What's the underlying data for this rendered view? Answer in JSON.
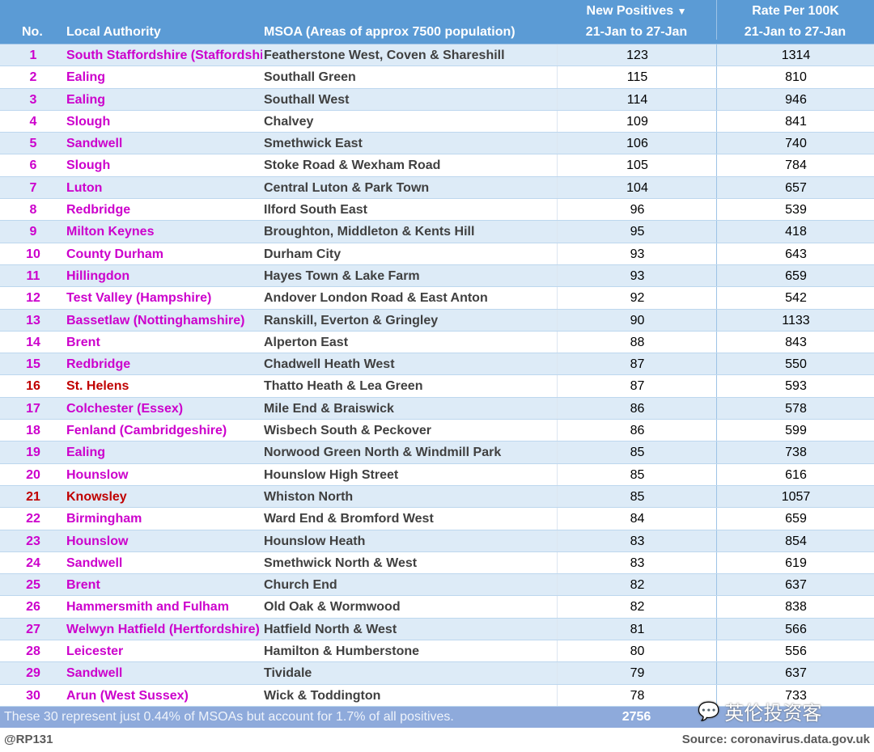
{
  "header": {
    "no": "No.",
    "la": "Local Authority",
    "msoa": "MSOA (Areas of approx 7500 population)",
    "np_title": "New Positives",
    "np_sort_icon": "triangle-down",
    "np_period": "21-Jan to 27-Jan",
    "rate_title": "Rate Per 100K",
    "rate_period": "21-Jan to 27-Jan"
  },
  "colors": {
    "header": "#5b9bd5",
    "alt_row": "#ddebf7",
    "authority_default": "#cc00cc",
    "authority_highlight": "#c00000",
    "footer": "#8eaadb"
  },
  "rows": [
    {
      "no": "1",
      "la": "South Staffordshire (Staffordshire)",
      "msoa": "Featherstone West, Coven & Shareshill",
      "np": "123",
      "rate": "1314"
    },
    {
      "no": "2",
      "la": "Ealing",
      "msoa": "Southall Green",
      "np": "115",
      "rate": "810"
    },
    {
      "no": "3",
      "la": "Ealing",
      "msoa": "Southall West",
      "np": "114",
      "rate": "946"
    },
    {
      "no": "4",
      "la": "Slough",
      "msoa": "Chalvey",
      "np": "109",
      "rate": "841"
    },
    {
      "no": "5",
      "la": "Sandwell",
      "msoa": "Smethwick East",
      "np": "106",
      "rate": "740"
    },
    {
      "no": "6",
      "la": "Slough",
      "msoa": "Stoke Road & Wexham Road",
      "np": "105",
      "rate": "784"
    },
    {
      "no": "7",
      "la": "Luton",
      "msoa": "Central Luton & Park Town",
      "np": "104",
      "rate": "657"
    },
    {
      "no": "8",
      "la": "Redbridge",
      "msoa": "Ilford South East",
      "np": "96",
      "rate": "539"
    },
    {
      "no": "9",
      "la": "Milton Keynes",
      "msoa": "Broughton, Middleton & Kents Hill",
      "np": "95",
      "rate": "418"
    },
    {
      "no": "10",
      "la": "County Durham",
      "msoa": "Durham City",
      "np": "93",
      "rate": "643"
    },
    {
      "no": "11",
      "la": "Hillingdon",
      "msoa": "Hayes Town & Lake Farm",
      "np": "93",
      "rate": "659"
    },
    {
      "no": "12",
      "la": "Test Valley (Hampshire)",
      "msoa": "Andover London Road & East Anton",
      "np": "92",
      "rate": "542"
    },
    {
      "no": "13",
      "la": "Bassetlaw (Nottinghamshire)",
      "msoa": "Ranskill, Everton & Gringley",
      "np": "90",
      "rate": "1133"
    },
    {
      "no": "14",
      "la": "Brent",
      "msoa": "Alperton East",
      "np": "88",
      "rate": "843"
    },
    {
      "no": "15",
      "la": "Redbridge",
      "msoa": "Chadwell Heath West",
      "np": "87",
      "rate": "550"
    },
    {
      "no": "16",
      "la": "St. Helens",
      "msoa": "Thatto Heath & Lea Green",
      "np": "87",
      "rate": "593",
      "highlight": true
    },
    {
      "no": "17",
      "la": "Colchester (Essex)",
      "msoa": "Mile End & Braiswick",
      "np": "86",
      "rate": "578"
    },
    {
      "no": "18",
      "la": "Fenland (Cambridgeshire)",
      "msoa": "Wisbech South & Peckover",
      "np": "86",
      "rate": "599"
    },
    {
      "no": "19",
      "la": "Ealing",
      "msoa": "Norwood Green North & Windmill Park",
      "np": "85",
      "rate": "738"
    },
    {
      "no": "20",
      "la": "Hounslow",
      "msoa": "Hounslow High Street",
      "np": "85",
      "rate": "616"
    },
    {
      "no": "21",
      "la": "Knowsley",
      "msoa": "Whiston North",
      "np": "85",
      "rate": "1057",
      "highlight": true
    },
    {
      "no": "22",
      "la": "Birmingham",
      "msoa": "Ward End & Bromford West",
      "np": "84",
      "rate": "659"
    },
    {
      "no": "23",
      "la": "Hounslow",
      "msoa": "Hounslow Heath",
      "np": "83",
      "rate": "854"
    },
    {
      "no": "24",
      "la": "Sandwell",
      "msoa": "Smethwick North & West",
      "np": "83",
      "rate": "619"
    },
    {
      "no": "25",
      "la": "Brent",
      "msoa": "Church End",
      "np": "82",
      "rate": "637"
    },
    {
      "no": "26",
      "la": "Hammersmith and Fulham",
      "msoa": "Old Oak & Wormwood",
      "np": "82",
      "rate": "838"
    },
    {
      "no": "27",
      "la": "Welwyn Hatfield (Hertfordshire)",
      "msoa": "Hatfield North & West",
      "np": "81",
      "rate": "566"
    },
    {
      "no": "28",
      "la": "Leicester",
      "msoa": "Hamilton & Humberstone",
      "np": "80",
      "rate": "556"
    },
    {
      "no": "29",
      "la": "Sandwell",
      "msoa": "Tividale",
      "np": "79",
      "rate": "637"
    },
    {
      "no": "30",
      "la": "Arun (West Sussex)",
      "msoa": "Wick & Toddington",
      "np": "78",
      "rate": "733"
    }
  ],
  "footer": {
    "note": "These 30 represent just 0.44% of MSOAs but account for 1.7% of all positives.",
    "total": "2756"
  },
  "bottom": {
    "handle": "@RP131",
    "source": "Source: coronavirus.data.gov.uk"
  },
  "watermark": {
    "text": "英伦投资客",
    "icon": "wechat-icon"
  }
}
